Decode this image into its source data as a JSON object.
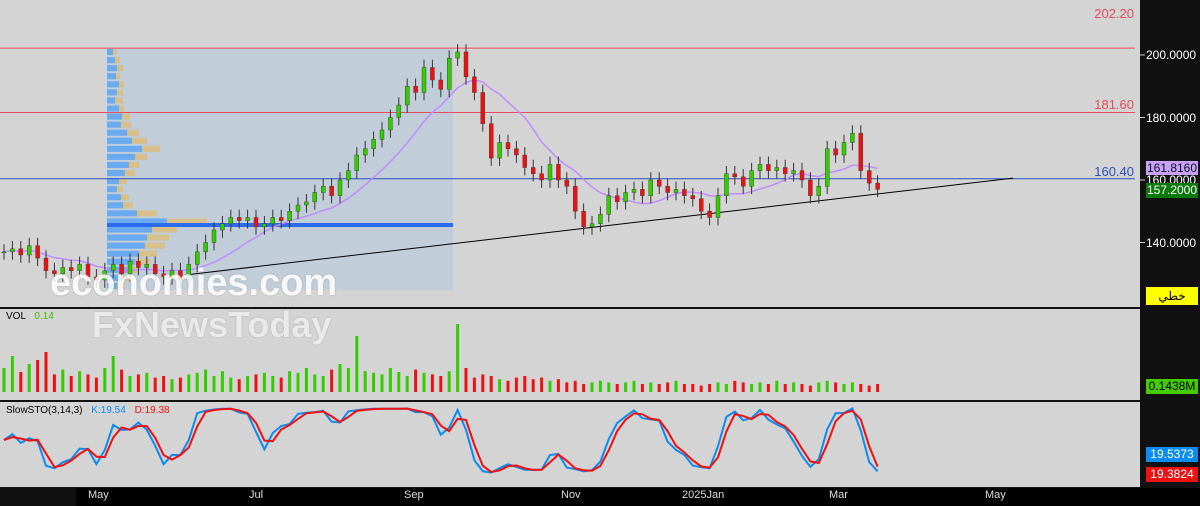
{
  "price_axis": {
    "ticks": [
      "200.0000",
      "180.0000",
      "140.0000"
    ],
    "tick_values": [
      200,
      180,
      140
    ],
    "hidden_tick": "160.0000"
  },
  "levels": [
    {
      "label": "202.20",
      "value": 202.2,
      "color": "#e84a5f"
    },
    {
      "label": "181.60",
      "value": 181.6,
      "color": "#e84a5f"
    },
    {
      "label": "160.40",
      "value": 160.4,
      "color": "#2b4fb5"
    }
  ],
  "tags": {
    "ma": "161.8160",
    "last": "157.2000",
    "chart_type": "خطي",
    "volume": "0.1438M",
    "k": "19.5373",
    "d": "19.3824"
  },
  "colors": {
    "up": "#33cc00",
    "down": "#ee1111",
    "ma": "#c08cff",
    "poc": "#2a6bf0"
  },
  "volume_label": {
    "name": "VOL",
    "value": "0.14"
  },
  "stoch_label": {
    "name": "SlowSTO(3,14,3)",
    "k": "K:19.54",
    "d": "D:19.38"
  },
  "watermark": {
    "line1": "economies.com",
    "line2": "FxNewsToday"
  },
  "x_axis": [
    "May",
    "Jul",
    "Sep",
    "Nov",
    "2025Jan",
    "Mar",
    "May"
  ],
  "poc_price": 145.6,
  "trendline": [
    [
      129.6,
      0
    ],
    [
      160.6,
      1
    ]
  ],
  "closes": [
    137,
    138,
    136,
    139,
    135,
    131,
    130,
    132,
    131,
    133,
    129,
    128,
    131,
    133,
    130,
    134,
    132,
    133,
    130,
    129,
    131,
    128,
    133,
    137,
    140,
    144,
    146,
    148,
    147,
    148,
    145,
    146,
    148,
    147,
    150,
    152,
    153,
    156,
    158,
    155,
    160,
    163,
    168,
    170,
    173,
    176,
    180,
    184,
    190,
    188,
    196,
    192,
    189,
    199,
    201,
    193,
    188,
    178,
    167,
    172,
    170,
    168,
    164,
    162,
    160,
    165,
    160,
    158,
    150,
    145,
    146,
    149,
    155,
    153,
    156,
    157,
    155,
    160,
    158,
    156,
    157,
    155,
    154,
    150,
    148,
    155,
    162,
    161,
    158,
    163,
    165,
    163,
    164,
    162,
    163,
    160,
    155,
    158,
    170,
    168,
    172,
    175,
    163,
    159,
    157
  ],
  "volumes": [
    30,
    45,
    25,
    35,
    40,
    50,
    22,
    28,
    20,
    26,
    22,
    18,
    30,
    45,
    28,
    20,
    22,
    24,
    18,
    20,
    16,
    18,
    22,
    24,
    28,
    20,
    26,
    18,
    16,
    20,
    22,
    24,
    20,
    18,
    26,
    24,
    30,
    22,
    20,
    28,
    35,
    30,
    70,
    26,
    24,
    22,
    30,
    25,
    20,
    28,
    24,
    22,
    20,
    26,
    85,
    30,
    18,
    22,
    20,
    16,
    14,
    18,
    20,
    16,
    18,
    14,
    16,
    12,
    14,
    10,
    12,
    14,
    12,
    10,
    12,
    14,
    10,
    12,
    10,
    12,
    14,
    10,
    10,
    8,
    10,
    12,
    10,
    14,
    12,
    10,
    12,
    10,
    14,
    10,
    12,
    10,
    8,
    12,
    14,
    12,
    10,
    12,
    10,
    8,
    10
  ],
  "volume_profile": [
    [
      6,
      4
    ],
    [
      8,
      5
    ],
    [
      10,
      6
    ],
    [
      9,
      4
    ],
    [
      12,
      5
    ],
    [
      10,
      6
    ],
    [
      8,
      8
    ],
    [
      12,
      5
    ],
    [
      15,
      8
    ],
    [
      14,
      10
    ],
    [
      20,
      12
    ],
    [
      25,
      15
    ],
    [
      35,
      18
    ],
    [
      28,
      12
    ],
    [
      22,
      10
    ],
    [
      18,
      10
    ],
    [
      12,
      8
    ],
    [
      10,
      6
    ],
    [
      14,
      8
    ],
    [
      16,
      10
    ],
    [
      30,
      20
    ],
    [
      60,
      40
    ],
    [
      45,
      25
    ],
    [
      40,
      22
    ],
    [
      38,
      20
    ],
    [
      32,
      18
    ],
    [
      28,
      15
    ],
    [
      20,
      12
    ],
    [
      16,
      10
    ],
    [
      10,
      8
    ]
  ]
}
